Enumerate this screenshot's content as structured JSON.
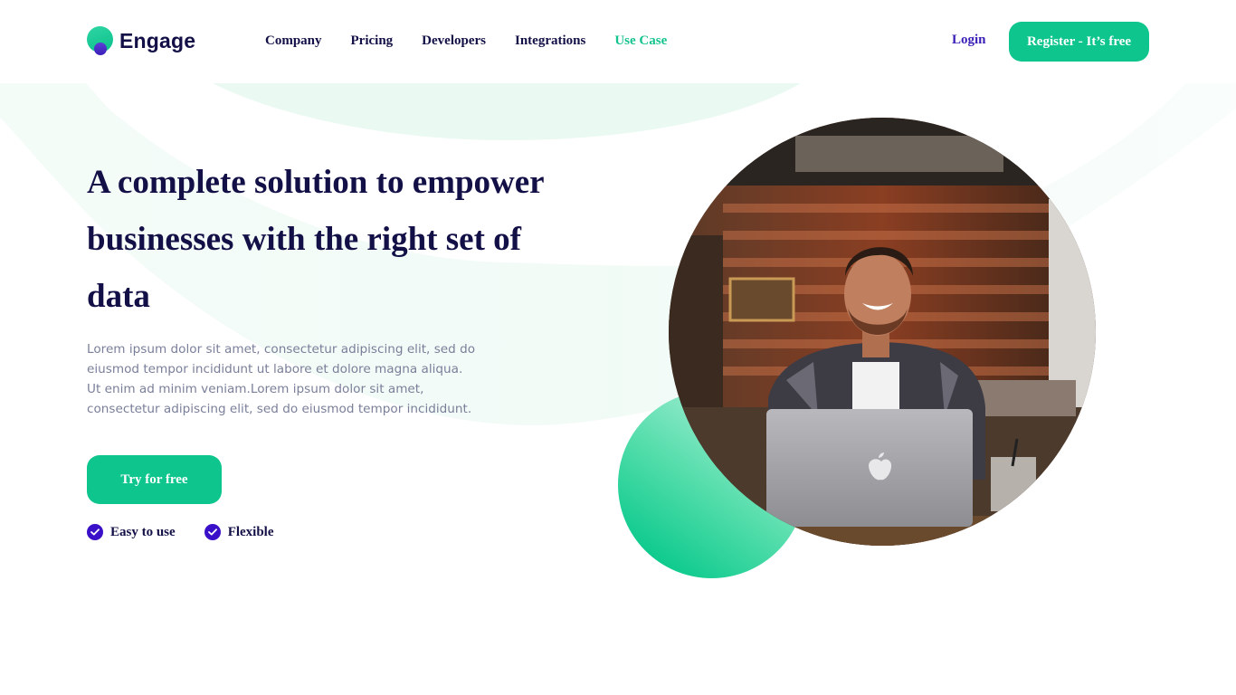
{
  "brand": {
    "name": "Engage",
    "green": "#14c38e",
    "navy": "#131047",
    "purple": "#3a1fb8"
  },
  "nav": {
    "items": [
      {
        "label": "Company",
        "active": false
      },
      {
        "label": "Pricing",
        "active": false
      },
      {
        "label": "Developers",
        "active": false
      },
      {
        "label": "Integrations",
        "active": false
      },
      {
        "label": "Use Case",
        "active": true
      }
    ]
  },
  "header": {
    "login_label": "Login",
    "register_label": "Register - It’s free"
  },
  "hero": {
    "title": "A complete solution to empower businesses with the right set of data",
    "description": "Lorem ipsum dolor sit amet, consectetur adipiscing elit, sed do eiusmod tempor incididunt ut labore et dolore magna aliqua. Ut enim ad minim veniam.Lorem ipsum dolor sit amet, consectetur adipiscing elit, sed do eiusmod tempor incididunt.",
    "cta_label": "Try for free",
    "features": [
      {
        "label": "Easy to use",
        "icon": "check-circle-icon"
      },
      {
        "label": "Flexible",
        "icon": "check-circle-icon"
      }
    ],
    "image": {
      "subject": "smiling-man-with-laptop-photo"
    }
  }
}
